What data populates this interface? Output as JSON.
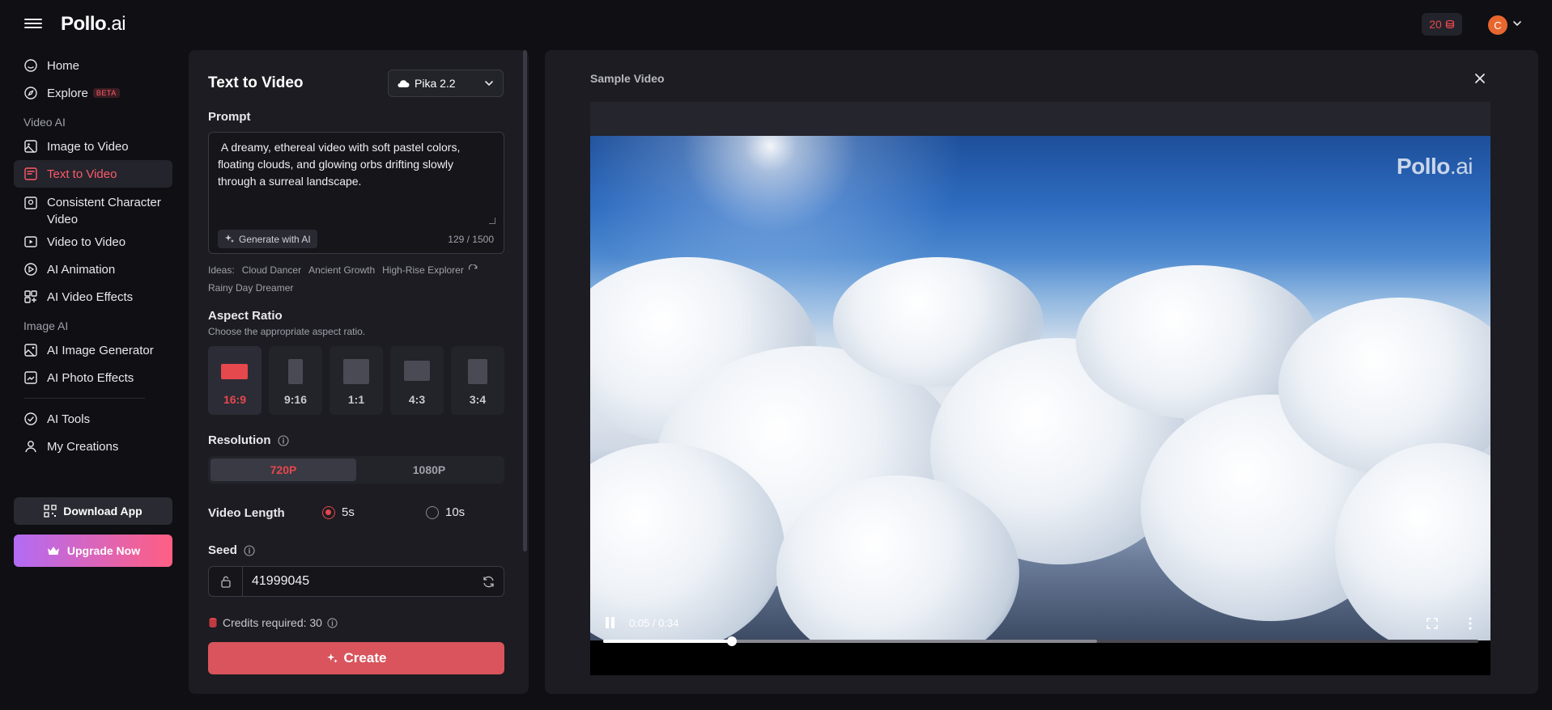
{
  "header": {
    "logo_main": "Pollo",
    "logo_suffix": ".ai",
    "credits": "20",
    "avatar_initial": "C"
  },
  "sidebar": {
    "home": "Home",
    "explore": "Explore",
    "explore_badge": "BETA",
    "section_video": "Video AI",
    "video_items": [
      "Image to Video",
      "Text to Video",
      "Consistent Character Video",
      "Video to Video",
      "AI Animation",
      "AI Video Effects"
    ],
    "active_item": "Text to Video",
    "section_image": "Image AI",
    "image_items": [
      "AI Image Generator",
      "AI Photo Effects"
    ],
    "tools": "AI Tools",
    "creations": "My Creations",
    "download_label": "Download App",
    "upgrade_label": "Upgrade Now"
  },
  "form": {
    "title": "Text to Video",
    "model": "Pika 2.2",
    "prompt_label": "Prompt",
    "prompt_value": " A dreamy, ethereal video with soft pastel colors, floating clouds, and glowing orbs drifting slowly through a surreal landscape.",
    "generate_ai_label": "Generate with AI",
    "char_count": "129 / 1500",
    "ideas_label": "Ideas:",
    "ideas": [
      "Cloud Dancer",
      "Ancient Growth",
      "High-Rise Explorer",
      "Rainy Day Dreamer"
    ],
    "aspect_label": "Aspect Ratio",
    "aspect_sub": "Choose the appropriate aspect ratio.",
    "ratios": [
      "16:9",
      "9:16",
      "1:1",
      "4:3",
      "3:4"
    ],
    "active_ratio": "16:9",
    "resolution_label": "Resolution",
    "resolutions": [
      "720P",
      "1080P"
    ],
    "active_resolution": "720P",
    "length_label": "Video Length",
    "lengths": [
      "5s",
      "10s"
    ],
    "active_length": "5s",
    "seed_label": "Seed",
    "seed_value": "41999045",
    "credits_required": "Credits required: 30",
    "create_label": "Create"
  },
  "video": {
    "title": "Sample Video",
    "watermark_main": "Pollo",
    "watermark_suffix": ".ai",
    "time": "0:05 / 0:34",
    "progress_fraction": 0.147,
    "buffered_fraction": 0.564
  },
  "colors": {
    "accent": "#e5484d",
    "background": "#0f0f14",
    "panel": "#1c1c22"
  }
}
